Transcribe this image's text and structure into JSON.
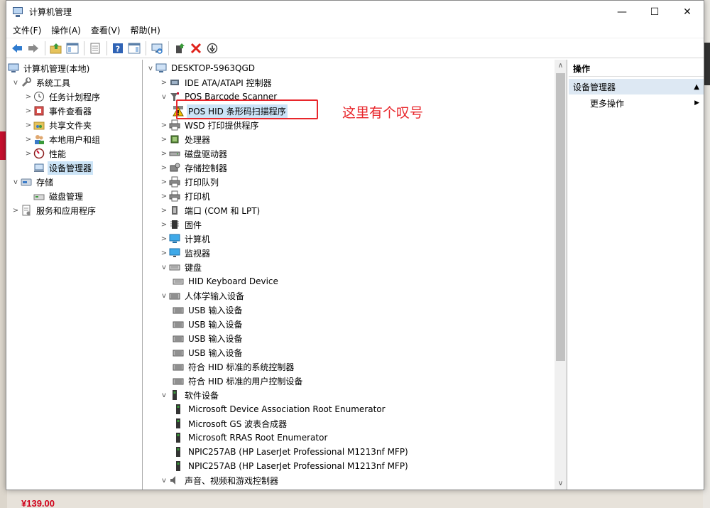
{
  "window": {
    "title": "计算机管理",
    "controls": [
      "—",
      "☐",
      "✕"
    ]
  },
  "menu": [
    "文件(F)",
    "操作(A)",
    "查看(V)",
    "帮助(H)"
  ],
  "left_tree": {
    "root": "计算机管理(本地)",
    "system_tools": "系统工具",
    "task_scheduler": "任务计划程序",
    "event_viewer": "事件查看器",
    "shared_folders": "共享文件夹",
    "local_users": "本地用户和组",
    "performance": "性能",
    "device_manager": "设备管理器",
    "storage": "存储",
    "disk_management": "磁盘管理",
    "services_apps": "服务和应用程序"
  },
  "device_tree": {
    "computer": "DESKTOP-5963QGD",
    "items": [
      {
        "level": 1,
        "exp": ">",
        "icon": "ide-icon",
        "label": "IDE ATA/ATAPI 控制器"
      },
      {
        "level": 1,
        "exp": "v",
        "icon": "barcode-scanner-icon",
        "label": "POS Barcode Scanner"
      },
      {
        "level": 2,
        "exp": "",
        "icon": "warning-icon",
        "label": "POS HID 条形码扫描程序"
      },
      {
        "level": 1,
        "exp": ">",
        "icon": "printer-icon",
        "label": "WSD 打印提供程序"
      },
      {
        "level": 1,
        "exp": ">",
        "icon": "processor-icon",
        "label": "处理器"
      },
      {
        "level": 1,
        "exp": ">",
        "icon": "disk-drive-icon",
        "label": "磁盘驱动器"
      },
      {
        "level": 1,
        "exp": ">",
        "icon": "storage-controller-icon",
        "label": "存储控制器"
      },
      {
        "level": 1,
        "exp": ">",
        "icon": "printer-icon",
        "label": "打印队列"
      },
      {
        "level": 1,
        "exp": ">",
        "icon": "printer-icon",
        "label": "打印机"
      },
      {
        "level": 1,
        "exp": ">",
        "icon": "port-icon",
        "label": "端口 (COM 和 LPT)"
      },
      {
        "level": 1,
        "exp": ">",
        "icon": "firmware-icon",
        "label": "固件"
      },
      {
        "level": 1,
        "exp": ">",
        "icon": "computer-icon",
        "label": "计算机"
      },
      {
        "level": 1,
        "exp": ">",
        "icon": "monitor-icon",
        "label": "监视器"
      },
      {
        "level": 1,
        "exp": "v",
        "icon": "keyboard-icon",
        "label": "键盘"
      },
      {
        "level": 2,
        "exp": "",
        "icon": "keyboard-icon",
        "label": "HID Keyboard Device"
      },
      {
        "level": 1,
        "exp": "v",
        "icon": "hid-icon",
        "label": "人体学输入设备"
      },
      {
        "level": 2,
        "exp": "",
        "icon": "hid-icon",
        "label": "USB 输入设备"
      },
      {
        "level": 2,
        "exp": "",
        "icon": "hid-icon",
        "label": "USB 输入设备"
      },
      {
        "level": 2,
        "exp": "",
        "icon": "hid-icon",
        "label": "USB 输入设备"
      },
      {
        "level": 2,
        "exp": "",
        "icon": "hid-icon",
        "label": "USB 输入设备"
      },
      {
        "level": 2,
        "exp": "",
        "icon": "hid-icon",
        "label": "符合 HID 标准的系统控制器"
      },
      {
        "level": 2,
        "exp": "",
        "icon": "hid-icon",
        "label": "符合 HID 标准的用户控制设备"
      },
      {
        "level": 1,
        "exp": "v",
        "icon": "software-device-icon",
        "label": "软件设备"
      },
      {
        "level": 2,
        "exp": "",
        "icon": "software-device-icon",
        "label": "Microsoft Device Association Root Enumerator"
      },
      {
        "level": 2,
        "exp": "",
        "icon": "software-device-icon",
        "label": "Microsoft GS 波表合成器"
      },
      {
        "level": 2,
        "exp": "",
        "icon": "software-device-icon",
        "label": "Microsoft RRAS Root Enumerator"
      },
      {
        "level": 2,
        "exp": "",
        "icon": "software-device-icon",
        "label": "NPIC257AB (HP LaserJet Professional M1213nf MFP)"
      },
      {
        "level": 2,
        "exp": "",
        "icon": "software-device-icon",
        "label": "NPIC257AB (HP LaserJet Professional M1213nf MFP)"
      },
      {
        "level": 1,
        "exp": "v",
        "icon": "sound-icon",
        "label": "声音、视频和游戏控制器"
      }
    ]
  },
  "annotation": "这里有个叹号",
  "actions": {
    "header": "操作",
    "section": "设备管理器",
    "more": "更多操作"
  },
  "background": {
    "price": "¥139.00"
  },
  "colors": {
    "highlight_red": "#e8262b",
    "selection": "#cce4f7",
    "actions_section": "#dde8f3"
  }
}
